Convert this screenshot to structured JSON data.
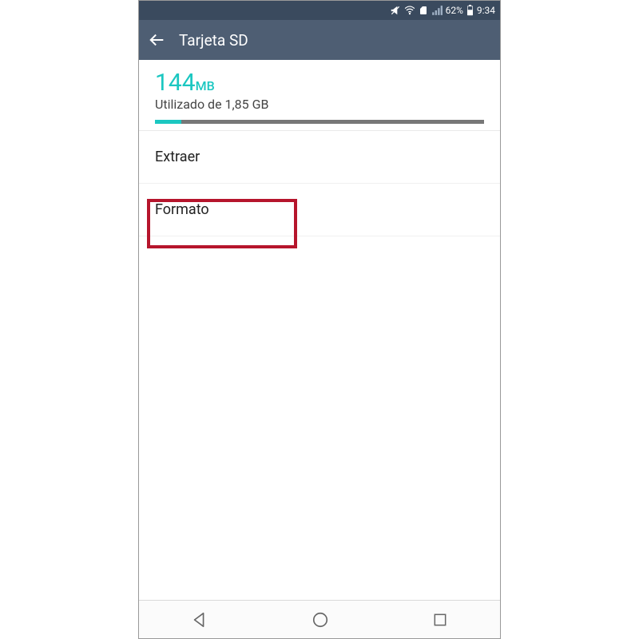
{
  "status": {
    "battery_pct": "62%",
    "time": "9:34"
  },
  "header": {
    "title": "Tarjeta SD"
  },
  "storage": {
    "used_value": "144",
    "used_unit": "MB",
    "used_subtitle": "Utilizado de 1,85 GB",
    "used_fraction_pct": "8%"
  },
  "actions": {
    "eject_label": "Extraer",
    "format_label": "Formato"
  },
  "colors": {
    "accent": "#1bc7c1",
    "appbar": "#4e5e73",
    "statusbar": "#3a4a5e",
    "highlight": "#b6152c"
  }
}
